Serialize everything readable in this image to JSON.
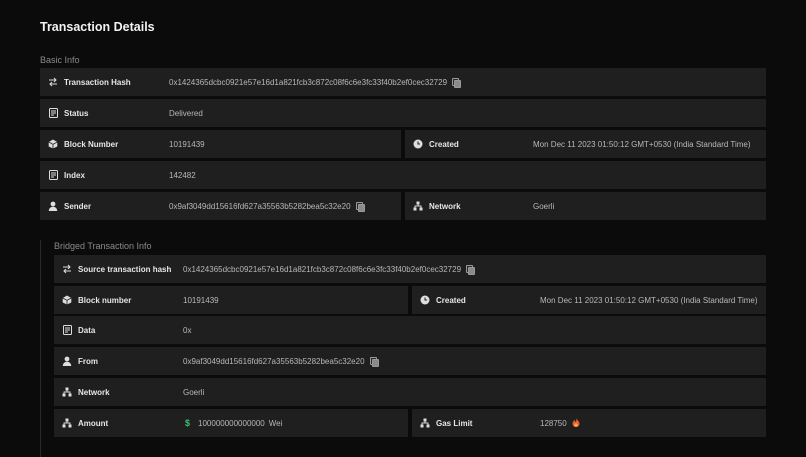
{
  "page": {
    "title": "Transaction Details"
  },
  "basic": {
    "title": "Basic Info",
    "tx_hash_label": "Transaction Hash",
    "tx_hash": "0x1424365dcbc0921e57e16d1a821fcb3c872c08f6c6e3fc33f40b2ef0cec32729",
    "status_label": "Status",
    "status": "Delivered",
    "block_label": "Block Number",
    "block": "10191439",
    "created_label": "Created",
    "created": "Mon Dec 11 2023 01:50:12 GMT+0530 (India Standard Time)",
    "index_label": "Index",
    "index": "142482",
    "sender_label": "Sender",
    "sender": "0x9af3049dd15616fd627a35563b5282bea5c32e20",
    "network_label": "Network",
    "network": "Goerli"
  },
  "bridged": {
    "title": "Bridged Transaction Info",
    "src_hash_label": "Source transaction hash",
    "src_hash": "0x1424365dcbc0921e57e16d1a821fcb3c872c08f6c6e3fc33f40b2ef0cec32729",
    "block_label": "Block number",
    "block": "10191439",
    "created_label": "Created",
    "created": "Mon Dec 11 2023 01:50:12 GMT+0530 (India Standard Time)",
    "data_label": "Data",
    "data": "0x",
    "from_label": "From",
    "from": "0x9af3049dd15616fd627a35563b5282bea5c32e20",
    "network_label": "Network",
    "network": "Goerli",
    "amount_label": "Amount",
    "amount_symbol": "$",
    "amount": "100000000000000",
    "amount_unit": "Wei",
    "gas_label": "Gas Limit",
    "gas": "128750"
  },
  "colors": {
    "row_bg": "#1f1f1f",
    "page_bg": "#0b0b0b",
    "accent_green": "#3fbf6f",
    "flame": "#e8622c"
  }
}
